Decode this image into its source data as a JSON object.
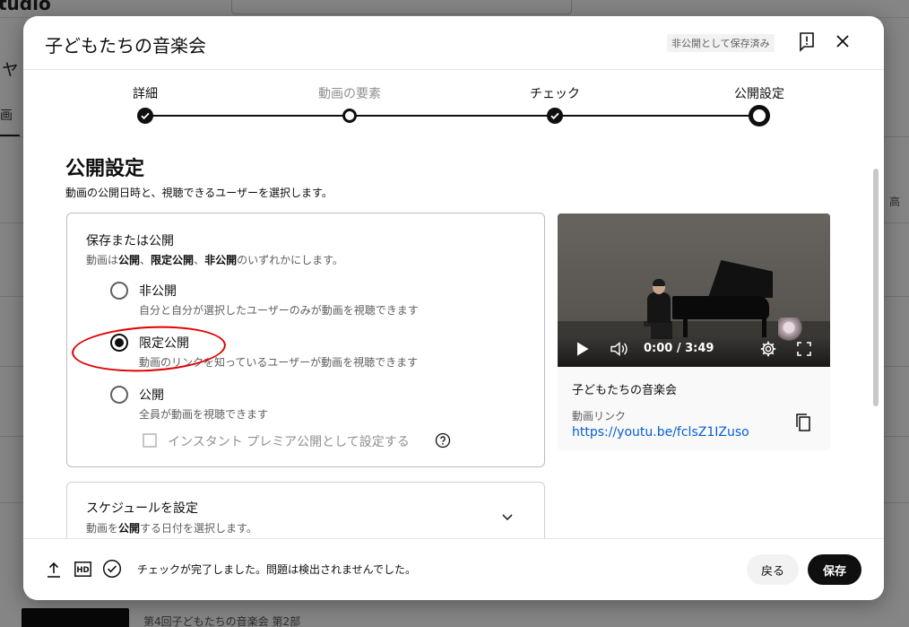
{
  "dialog": {
    "title": "子どもたちの音楽会",
    "save_status": "非公開として保存済み"
  },
  "steps": [
    {
      "label": "詳細",
      "state": "done"
    },
    {
      "label": "動画の要素",
      "state": "skipped"
    },
    {
      "label": "チェック",
      "state": "done"
    },
    {
      "label": "公開設定",
      "state": "current"
    }
  ],
  "visibility": {
    "title": "公開設定",
    "description": "動画の公開日時と、視聴できるユーザーを選択します。",
    "box_heading": "保存または公開",
    "box_sub_parts": [
      "動画は",
      "公開",
      "、",
      "限定公開",
      "、",
      "非公開",
      "のいずれかにします。"
    ],
    "options": [
      {
        "label": "非公開",
        "desc": "自分と自分が選択したユーザーのみが動画を視聴できます",
        "checked": false
      },
      {
        "label": "限定公開",
        "desc": "動画のリンクを知っているユーザーが動画を視聴できます",
        "checked": true
      },
      {
        "label": "公開",
        "desc": "全員が動画を視聴できます",
        "checked": false
      }
    ],
    "premiere_label": "インスタント プレミア公開として設定する"
  },
  "schedule": {
    "title": "スケジュールを設定",
    "desc_parts": [
      "動画を",
      "公開",
      "する日付を選択します。"
    ]
  },
  "preview": {
    "time": "0:00 / 3:49",
    "title": "子どもたちの音楽会",
    "link_label": "動画リンク",
    "link": "https://youtu.be/fclsZ1IZuso"
  },
  "footer": {
    "status": "チェックが完了しました。問題は検出されませんでした。",
    "back_label": "戻る",
    "save_label": "保存"
  },
  "background": {
    "logo": "tudio",
    "left_text": "ャ",
    "left_tab": "画",
    "right_text": "高",
    "bottom_row": "第4回子どもたちの音楽会 第2部"
  },
  "colors": {
    "annotation": "#e00000",
    "link": "#065fd4",
    "primary_button": "#0f0f0f"
  }
}
